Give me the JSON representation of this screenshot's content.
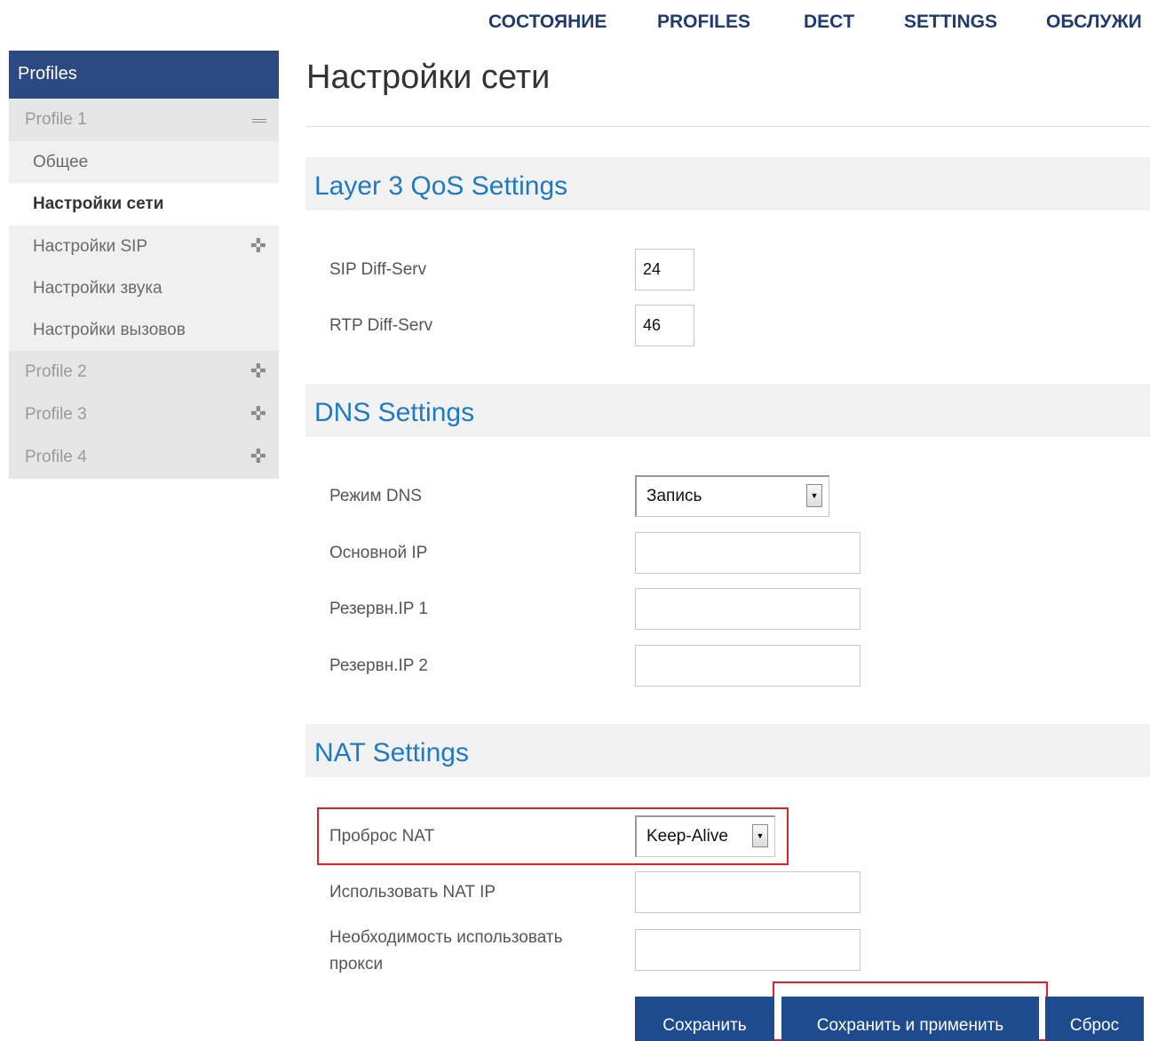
{
  "nav": {
    "items": [
      "СОСТОЯНИЕ",
      "PROFILES",
      "DECT",
      "SETTINGS",
      "ОБСЛУЖИ"
    ]
  },
  "sidebar": {
    "header": "Profiles",
    "profile1": "Profile 1",
    "sub_items": [
      "Общее",
      "Настройки сети",
      "Настройки SIP",
      "Настройки звука",
      "Настройки вызовов"
    ],
    "profile2": "Profile 2",
    "profile3": "Profile 3",
    "profile4": "Profile 4"
  },
  "page": {
    "title": "Настройки сети"
  },
  "qos": {
    "section_title": "Layer 3 QoS Settings",
    "sip_label": "SIP Diff-Serv",
    "sip_value": "24",
    "rtp_label": "RTP Diff-Serv",
    "rtp_value": "46"
  },
  "dns": {
    "section_title": "DNS Settings",
    "mode_label": "Режим DNS",
    "mode_value": "Запись",
    "primary_label": "Основной IP",
    "primary_value": "",
    "backup1_label": "Резервн.IP 1",
    "backup1_value": "",
    "backup2_label": "Резервн.IP 2",
    "backup2_value": ""
  },
  "nat": {
    "section_title": "NAT Settings",
    "traversal_label": "Проброс NAT",
    "traversal_value": "Keep-Alive",
    "use_nat_ip_label": "Использовать NAT IP",
    "use_nat_ip_value": "",
    "proxy_label_line1": "Необходимость использовать",
    "proxy_label_line2": "прокси",
    "proxy_value": ""
  },
  "buttons": {
    "save": "Сохранить",
    "save_apply": "Сохранить и применить",
    "reset": "Сброс"
  },
  "colors": {
    "nav_text": "#1f3b6e",
    "sidebar_header": "#2c4a82",
    "section_title": "#1f7ac4",
    "button": "#1e4a8e",
    "highlight": "#e0202a"
  }
}
